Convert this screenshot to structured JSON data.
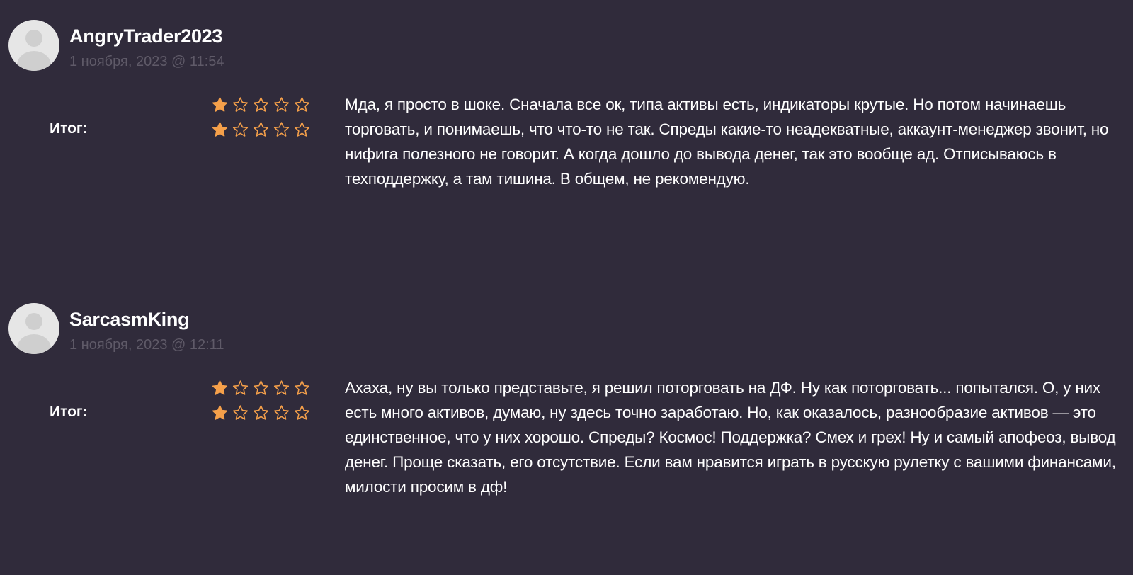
{
  "colors": {
    "background": "#302b3b",
    "star": "#f5a04a",
    "date": "#5f5a68",
    "text": "#ffffff"
  },
  "rating_label": "Итог:",
  "reviews": [
    {
      "author": "AngryTrader2023",
      "date": "1 ноября, 2023 @ 11:54",
      "ratings": [
        1,
        1
      ],
      "max_rating": 5,
      "text": "Мда, я просто в шоке. Сначала все ок, типа активы есть, индикаторы крутые. Но потом начинаешь торговать, и понимаешь, что что-то не так. Спреды какие-то неадекватные, аккаунт-менеджер звонит, но нифига полезного не говорит. А когда дошло до вывода денег, так это вообще ад. Отписываюсь в техподдержку, а там тишина. В общем, не рекомендую."
    },
    {
      "author": "SarcasmKing",
      "date": "1 ноября, 2023 @ 12:11",
      "ratings": [
        1,
        1
      ],
      "max_rating": 5,
      "text": "Ахаха, ну вы только представьте, я решил поторговать на ДФ. Ну как поторговать... попытался. О, у них есть много активов, думаю, ну здесь точно заработаю. Но, как оказалось, разнообразие активов — это единственное, что у них хорошо. Спреды? Космос! Поддержка? Смех и грех! Ну и самый апофеоз, вывод денег. Проще сказать, его отсутствие. Если вам нравится играть в русскую рулетку с вашими финансами, милости просим в дф!"
    }
  ]
}
